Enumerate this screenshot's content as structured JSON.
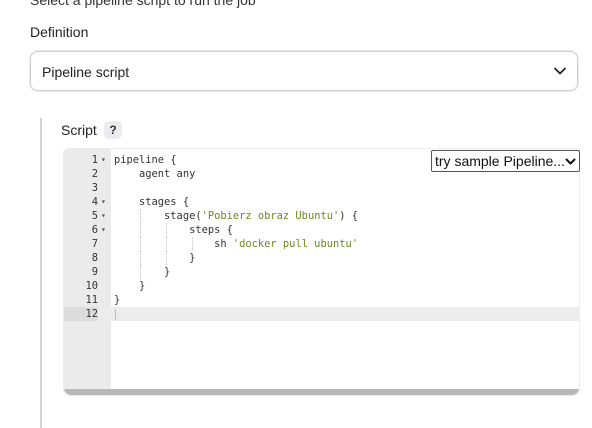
{
  "top_partial_text": "Select a pipeline script to run the job",
  "definition": {
    "label": "Definition",
    "selected": "Pipeline script"
  },
  "script": {
    "label": "Script",
    "help": "?"
  },
  "sample_select": {
    "selected": "try sample Pipeline..."
  },
  "editor": {
    "lines": [
      {
        "n": "1",
        "fold": true,
        "text": "pipeline {"
      },
      {
        "n": "2",
        "fold": false,
        "text": "    agent any"
      },
      {
        "n": "3",
        "fold": false,
        "text": ""
      },
      {
        "n": "4",
        "fold": true,
        "text": "    stages {"
      },
      {
        "n": "5",
        "fold": true,
        "text": "        stage(",
        "str": "'Pobierz obraz Ubuntu'",
        "after": ") {"
      },
      {
        "n": "6",
        "fold": true,
        "text": "            steps {"
      },
      {
        "n": "7",
        "fold": false,
        "text": "                sh ",
        "str": "'docker pull ubuntu'",
        "after": ""
      },
      {
        "n": "8",
        "fold": false,
        "text": "            }"
      },
      {
        "n": "9",
        "fold": false,
        "text": "        }"
      },
      {
        "n": "10",
        "fold": false,
        "text": "    }"
      },
      {
        "n": "11",
        "fold": false,
        "text": "}"
      },
      {
        "n": "12",
        "fold": false,
        "text": "",
        "active": true
      }
    ]
  },
  "colors": {
    "string": "#6a8a1a",
    "gutter": "#ebebeb",
    "active_line": "#ececec"
  }
}
